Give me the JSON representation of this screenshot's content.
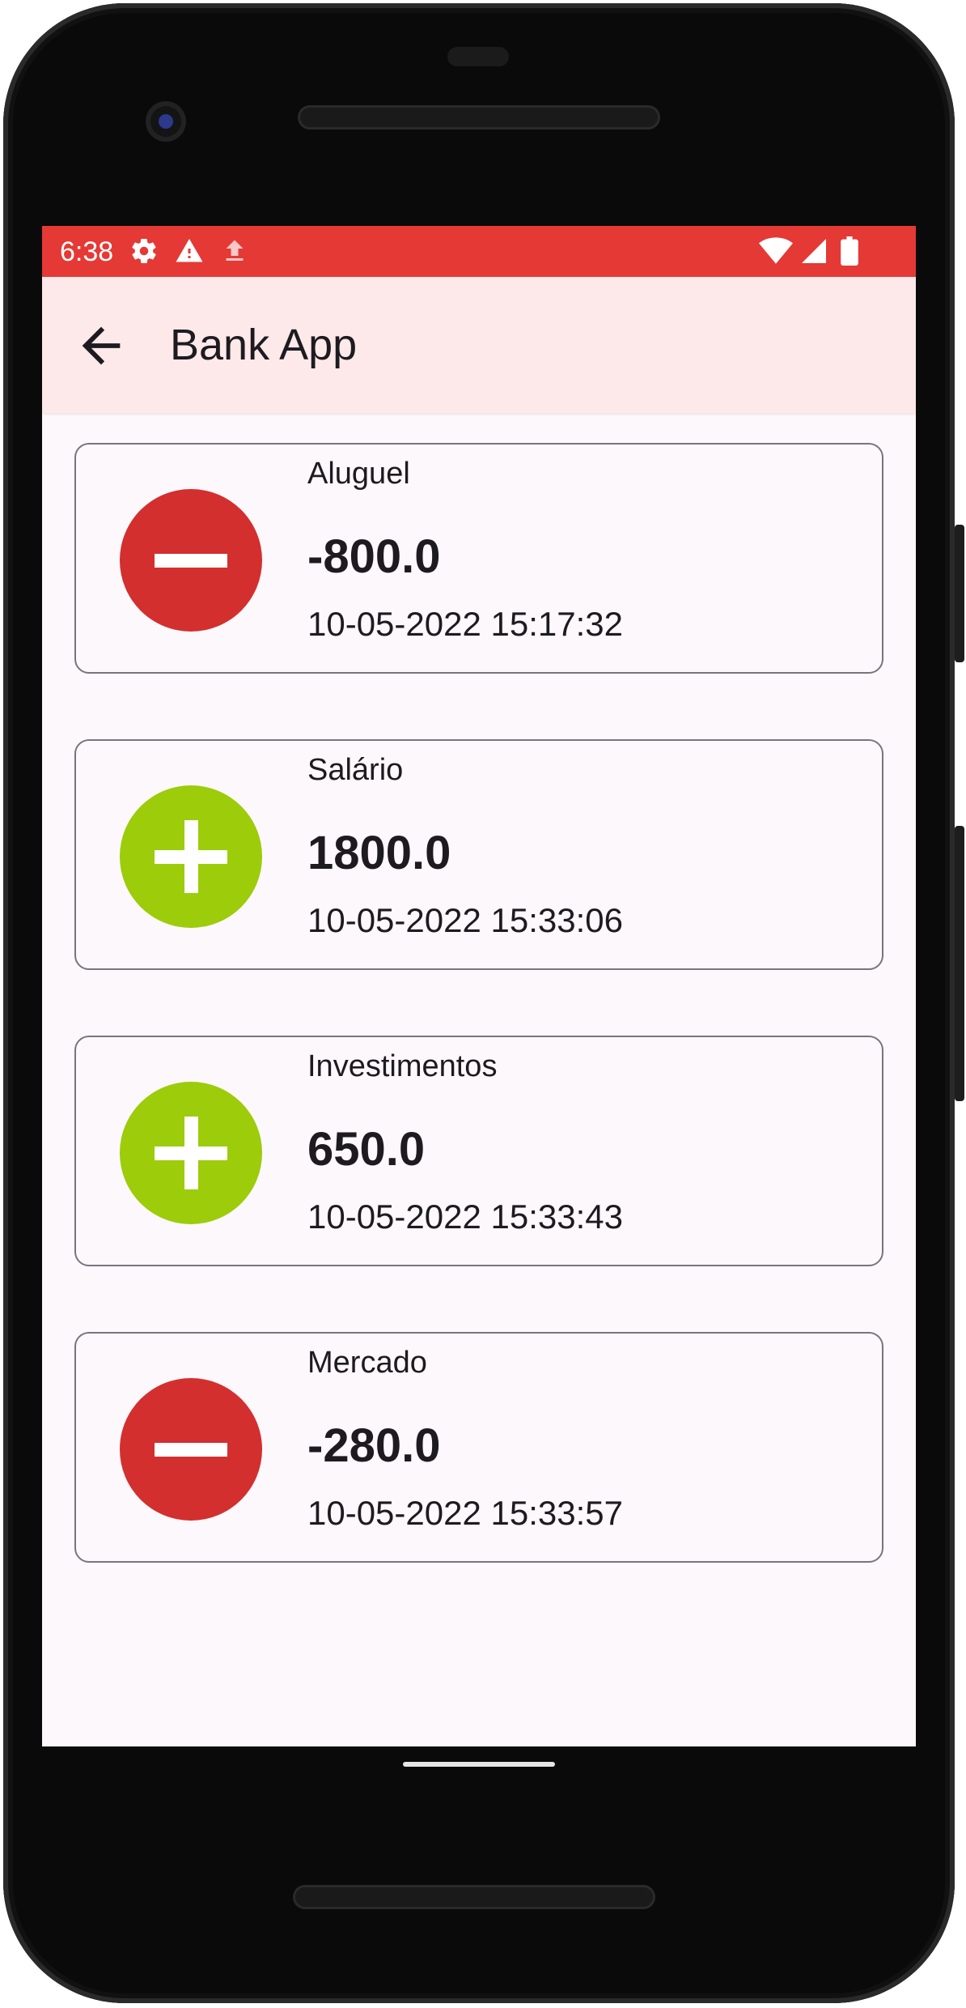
{
  "status_bar": {
    "time": "6:38",
    "left_icons": [
      "settings-gear-icon",
      "warning-icon",
      "upload-icon"
    ],
    "right_icons": [
      "wifi-icon",
      "cell-signal-icon",
      "battery-icon"
    ],
    "color": "#e53935"
  },
  "app_bar": {
    "title": "Bank App",
    "back_icon": "arrow-back-icon",
    "background": "#fde9ea"
  },
  "transactions": [
    {
      "name": "Aluguel",
      "value": "-800.0",
      "date": "10-05-2022 15:17:32",
      "type": "debit",
      "icon": "minus-icon",
      "color": "#d32f2f"
    },
    {
      "name": "Salário",
      "value": "1800.0",
      "date": "10-05-2022 15:33:06",
      "type": "credit",
      "icon": "plus-icon",
      "color": "#9ccc0a"
    },
    {
      "name": "Investimentos",
      "value": "650.0",
      "date": "10-05-2022 15:33:43",
      "type": "credit",
      "icon": "plus-icon",
      "color": "#9ccc0a"
    },
    {
      "name": "Mercado",
      "value": "-280.0",
      "date": "10-05-2022 15:33:57",
      "type": "debit",
      "icon": "minus-icon",
      "color": "#d32f2f"
    }
  ]
}
